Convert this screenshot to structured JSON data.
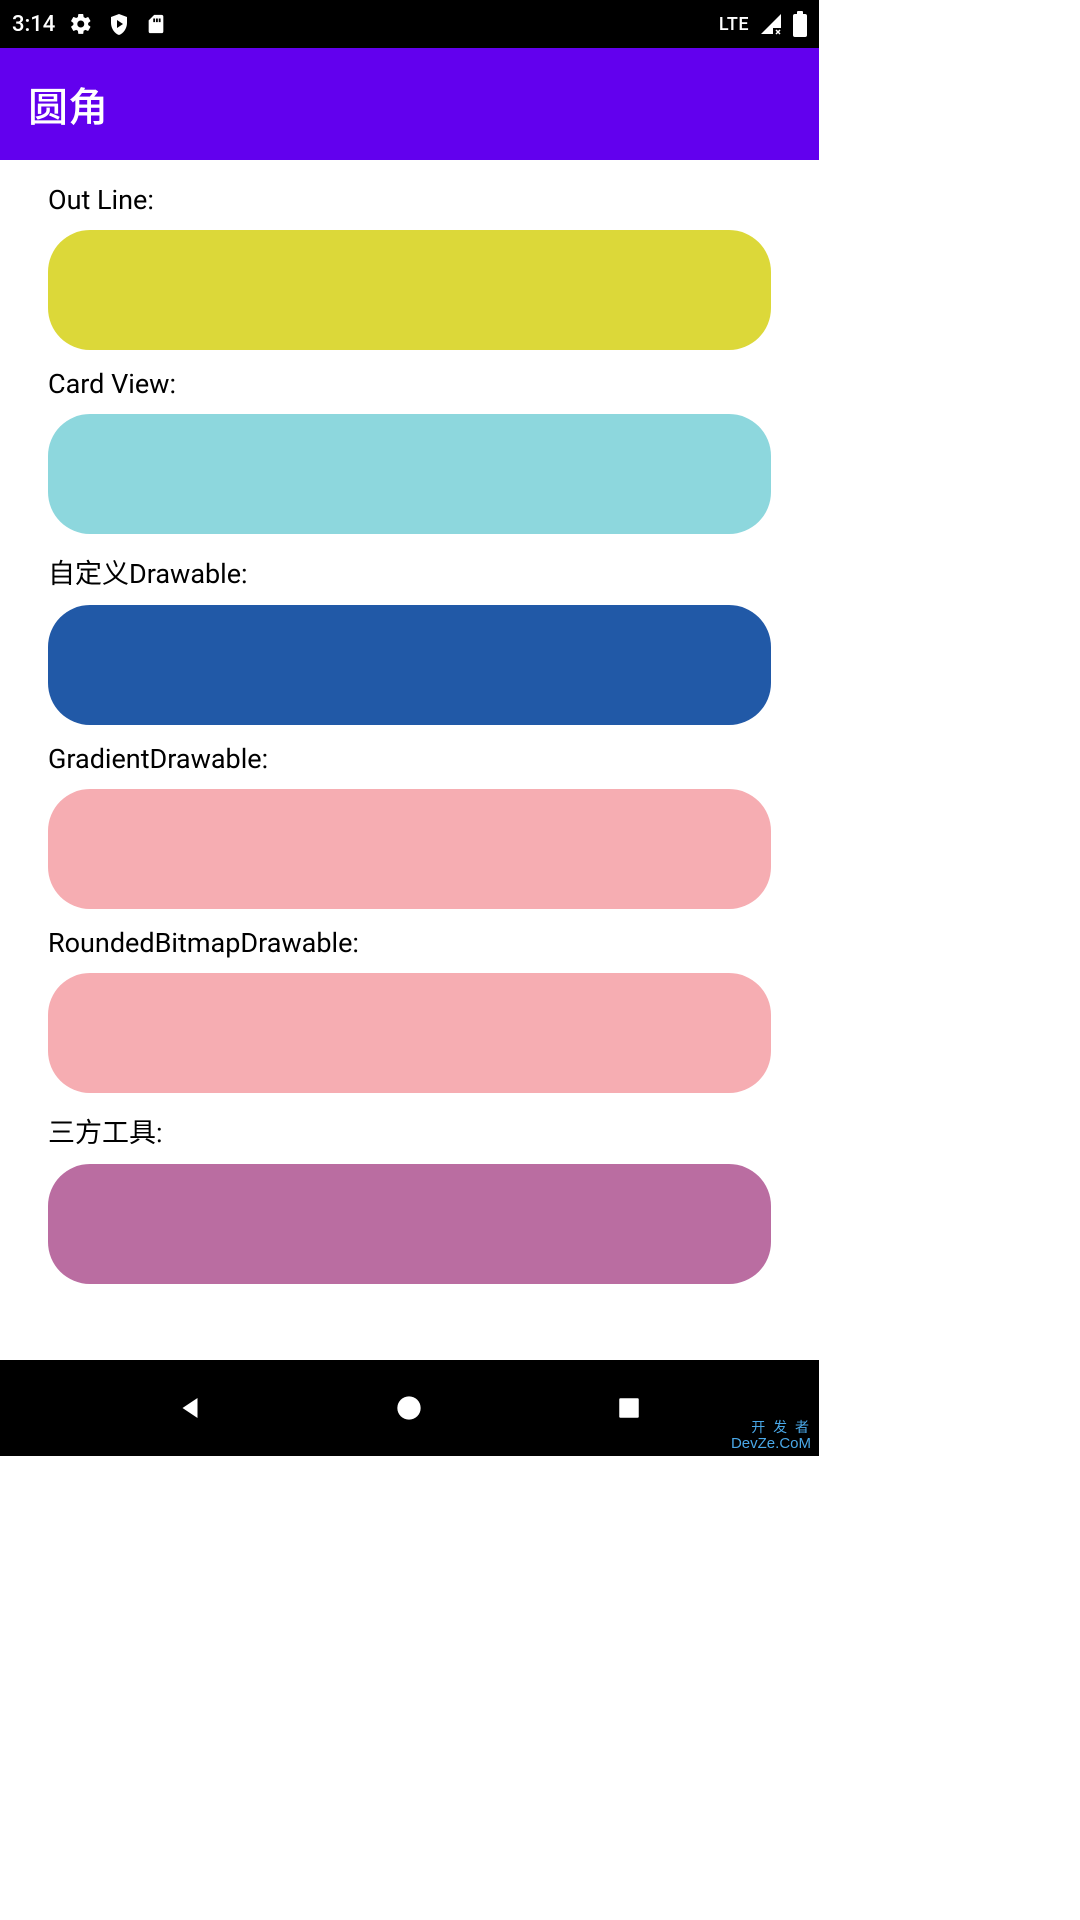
{
  "status": {
    "time": "3:14",
    "network": "LTE"
  },
  "appbar": {
    "title": "圆角"
  },
  "sections": [
    {
      "label": "Out Line:",
      "color": "#DCD839"
    },
    {
      "label": "Card View:",
      "color": "#8DD7DD"
    },
    {
      "label": "自定义Drawable:",
      "color": "#2159A7"
    },
    {
      "label": "GradientDrawable:",
      "color": "#F6ADB2"
    },
    {
      "label": "RoundedBitmapDrawable:",
      "color": "#F6ADB2"
    },
    {
      "label": "三方工具:",
      "color": "#BA6DA1"
    }
  ],
  "watermark": {
    "line1": "开 发 者",
    "line2": "DevZe.CoM"
  }
}
